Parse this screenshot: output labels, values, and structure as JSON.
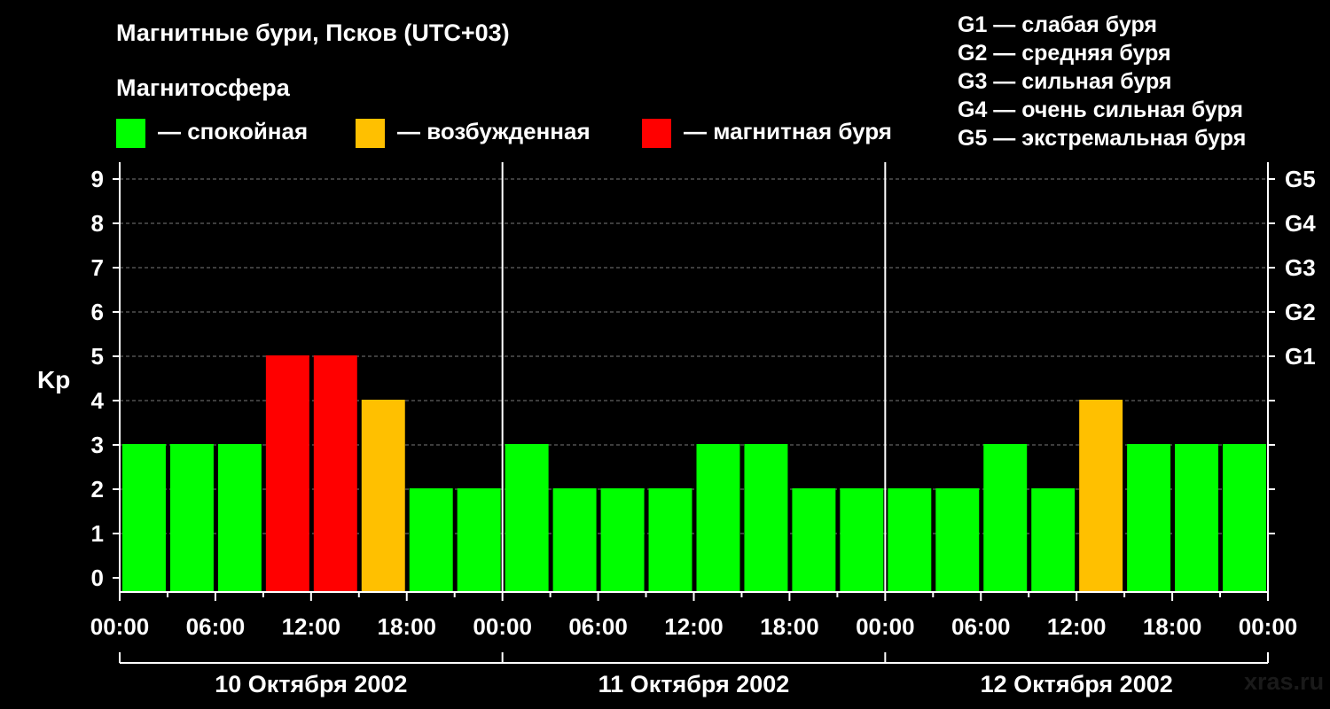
{
  "title": "Магнитные бури, Псков (UTC+03)",
  "legend": {
    "heading": "Магнитосфера",
    "items": [
      {
        "key": "quiet",
        "label": "— спокойная",
        "color": "#00ff00"
      },
      {
        "key": "disturbed",
        "label": "— возбужденная",
        "color": "#ffc000"
      },
      {
        "key": "storm",
        "label": "— магнитная буря",
        "color": "#ff0000"
      }
    ]
  },
  "g_scale": [
    "G1 — слабая буря",
    "G2 — средняя буря",
    "G3 — сильная буря",
    "G4 — очень сильная буря",
    "G5 — экстремальная буря"
  ],
  "watermark": "xras.ru",
  "chart_data": {
    "type": "bar",
    "ylabel": "Kp",
    "ylim": [
      0,
      9
    ],
    "y_ticks": [
      0,
      1,
      2,
      3,
      4,
      5,
      6,
      7,
      8,
      9
    ],
    "g_axis": [
      {
        "kp": 5,
        "label": "G1"
      },
      {
        "kp": 6,
        "label": "G2"
      },
      {
        "kp": 7,
        "label": "G3"
      },
      {
        "kp": 8,
        "label": "G4"
      },
      {
        "kp": 9,
        "label": "G5"
      }
    ],
    "x_tick_labels": [
      "00:00",
      "06:00",
      "12:00",
      "18:00",
      "00:00",
      "06:00",
      "12:00",
      "18:00",
      "00:00",
      "06:00",
      "12:00",
      "18:00",
      "00:00"
    ],
    "days": [
      "10 Октября 2002",
      "11 Октября 2002",
      "12 Октября 2002"
    ],
    "interval_hours": 3,
    "values": [
      3,
      3,
      3,
      5,
      5,
      4,
      2,
      2,
      3,
      2,
      2,
      2,
      3,
      3,
      2,
      2,
      2,
      2,
      3,
      2,
      4,
      3,
      3,
      3
    ],
    "levels": [
      "quiet",
      "quiet",
      "quiet",
      "storm",
      "storm",
      "disturbed",
      "quiet",
      "quiet",
      "quiet",
      "quiet",
      "quiet",
      "quiet",
      "quiet",
      "quiet",
      "quiet",
      "quiet",
      "quiet",
      "quiet",
      "quiet",
      "quiet",
      "disturbed",
      "quiet",
      "quiet",
      "quiet"
    ],
    "grid": true
  }
}
